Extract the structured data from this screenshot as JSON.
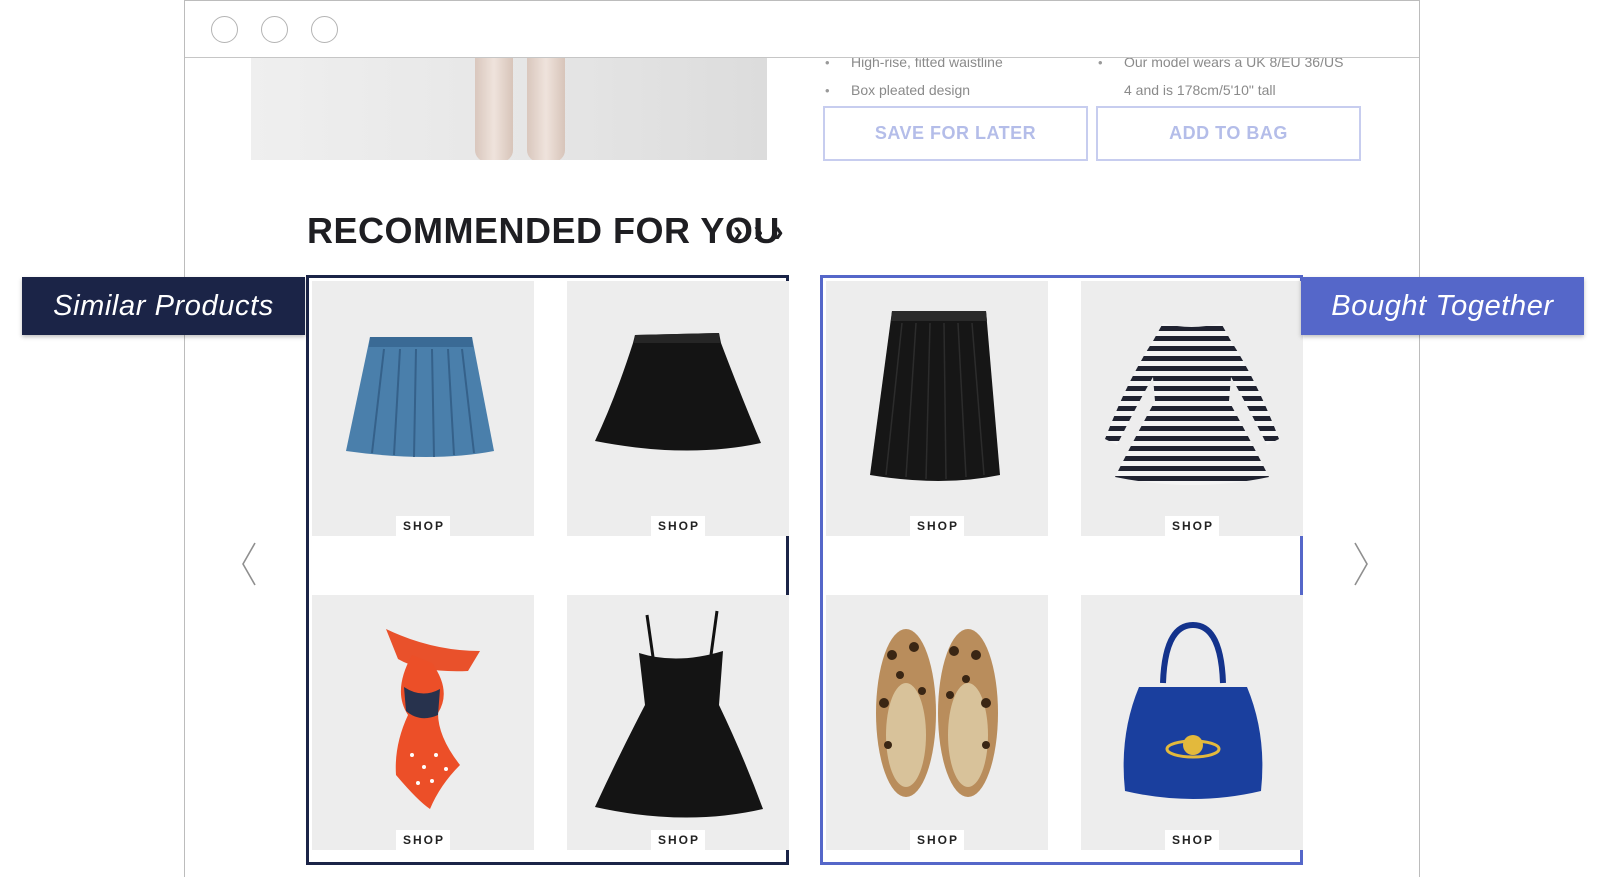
{
  "product": {
    "bullets_left": [
      "High-rise, fitted waistline",
      "Box pleated design"
    ],
    "bullets_right": [
      "Our model wears a UK 8/EU 36/US",
      "4 and is 178cm/5'10\" tall"
    ],
    "save_label": "SAVE FOR LATER",
    "add_label": "ADD TO BAG"
  },
  "recommended": {
    "title": "RECOMMENDED FOR YOU",
    "arrows": "› › ›"
  },
  "tags": {
    "similar": "Similar Products",
    "bought": "Bought Together"
  },
  "shop_label": "SHOP",
  "icons": {
    "prev": "chevron-left-icon",
    "next": "chevron-right-icon"
  },
  "colors": {
    "similar_accent": "#1b2447",
    "bought_accent": "#5567c9",
    "button_outline": "#c7cdef"
  }
}
